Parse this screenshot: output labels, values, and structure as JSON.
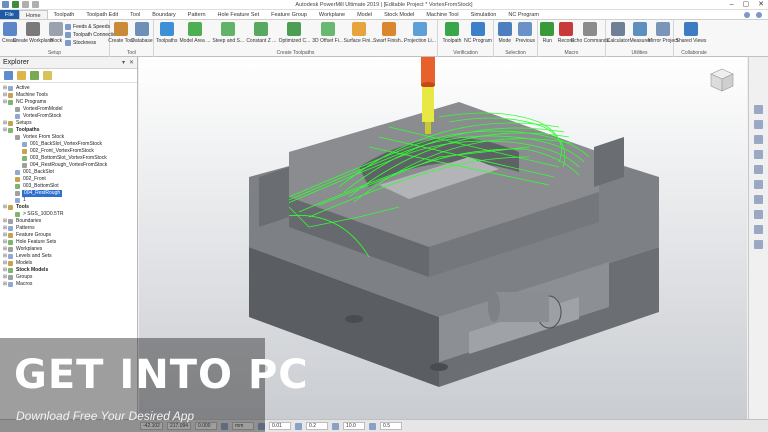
{
  "window": {
    "title": "Autodesk PowerMill Ultimate 2019  |  [Editable Project * VortexFromStock]"
  },
  "tabs": [
    "File",
    "Home",
    "Toolpath",
    "Toolpath Edit",
    "Tool",
    "Boundary",
    "Pattern",
    "Hole Feature Set",
    "Feature Group",
    "Workplane",
    "Model",
    "Stock Model",
    "Machine Tool",
    "Simulation",
    "NC Program"
  ],
  "ribbon": {
    "setup": {
      "label": "Setup",
      "create_workplane": "Create Workplane",
      "block": "Block",
      "feeds_speeds": "Feeds & Speeds",
      "toolpath_connections": "Toolpath Connections",
      "stockness": "Stockness",
      "create": "Create"
    },
    "tool": {
      "label": "Tool",
      "create_tool": "Create Tool",
      "database": "Database"
    },
    "create_toolpaths": {
      "label": "Create Toolpaths",
      "items": [
        "Toolpaths",
        "Model Area ...",
        "Steep and S...",
        "Constant Z ...",
        "Optimized C...",
        "3D Offset Fi...",
        "Surface Fini...",
        "Swarf Finish...",
        "Projection Li..."
      ]
    },
    "verification": {
      "label": "Verification",
      "toolpath": "Toolpath",
      "nc_program": "NC Program"
    },
    "selection": {
      "label": "Selection",
      "mode": "Mode",
      "previous": "Previous"
    },
    "macro": {
      "label": "Macro",
      "run": "Run",
      "record": "Record",
      "echo_commands": "Echo Commands"
    },
    "utilities": {
      "label": "Utilities",
      "calculator": "Calculator",
      "measurer": "Measurer",
      "mirror_project": "Mirror Project"
    },
    "collaborate": {
      "label": "Collaborate",
      "shared_views": "Shared Views"
    }
  },
  "explorer": {
    "title": "Explorer",
    "tree": [
      {
        "label": "Active",
        "depth": 0
      },
      {
        "label": "Machine Tools",
        "depth": 0
      },
      {
        "label": "NC Programs",
        "depth": 0
      },
      {
        "label": "VortexFromModel",
        "depth": 1
      },
      {
        "label": "VortexFromStock",
        "depth": 1
      },
      {
        "label": "Setups",
        "depth": 0
      },
      {
        "label": "Toolpaths",
        "depth": 0
      },
      {
        "label": "Vortex From Stock",
        "depth": 1
      },
      {
        "label": "001_BackSlot_VortexFromStock",
        "depth": 2
      },
      {
        "label": "002_Front_VortexFromStock",
        "depth": 2
      },
      {
        "label": "003_BottomSlot_VortexFromStock",
        "depth": 2
      },
      {
        "label": "004_RestRough_VortexFromStock",
        "depth": 2
      },
      {
        "label": "001_BackSlot",
        "depth": 1
      },
      {
        "label": "002_Front",
        "depth": 1
      },
      {
        "label": "003_BottomSlot",
        "depth": 1
      },
      {
        "label": "004_RestRough",
        "depth": 1
      },
      {
        "label": "1",
        "depth": 1
      },
      {
        "label": "Tools",
        "depth": 0
      },
      {
        "label": "> SGS_10D0.5TR",
        "depth": 1
      },
      {
        "label": "Boundaries",
        "depth": 0
      },
      {
        "label": "Patterns",
        "depth": 0
      },
      {
        "label": "Feature Groups",
        "depth": 0
      },
      {
        "label": "Hole Feature Sets",
        "depth": 0
      },
      {
        "label": "Workplanes",
        "depth": 0
      },
      {
        "label": "Levels and Sets",
        "depth": 0
      },
      {
        "label": "Models",
        "depth": 0
      },
      {
        "label": "Stock Models",
        "depth": 0
      },
      {
        "label": "Groups",
        "depth": 0
      },
      {
        "label": "Macros",
        "depth": 0
      }
    ]
  },
  "statusbar": {
    "x": "-42.102",
    "y": "217.094",
    "z": "0.000",
    "units": "mm",
    "tolerance": "0.01",
    "stepover": "0.2",
    "diameter": "10.0",
    "value": "0.5"
  },
  "watermark": {
    "title": "GET INTO PC",
    "subtitle": "Download Free Your Desired App"
  },
  "colors": {
    "file_tab": "#1e5aa8",
    "toolpath_green": "#33ff33",
    "tool_orange": "#e8602a",
    "holder_yellow": "#e8e844",
    "selection_blue": "#2f6fd1"
  }
}
